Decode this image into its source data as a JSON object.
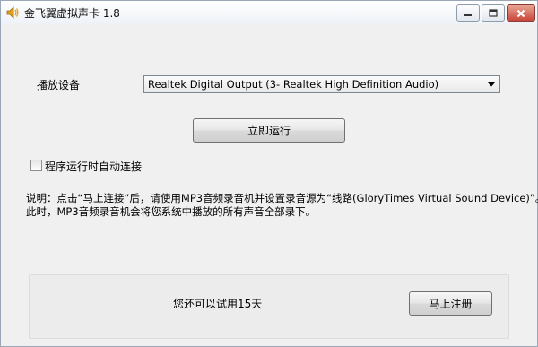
{
  "window": {
    "title": "金飞翼虚拟声卡 1.8",
    "icon": "speaker-icon"
  },
  "titlebar_buttons": {
    "minimize_icon": "minimize-icon",
    "maximize_icon": "maximize-icon",
    "close_icon": "close-icon"
  },
  "device": {
    "label": "播放设备",
    "selected": "Realtek Digital Output (3- Realtek High Definition Audio)"
  },
  "run_button": {
    "label": "立即运行"
  },
  "auto_connect": {
    "label": "程序运行时自动连接",
    "checked": false
  },
  "note": {
    "line1": "说明：点击“马上连接”后，请使用MP3音频录音机并设置录音源为“线路(GloryTimes Virtual Sound Device)”。",
    "line2": "此时，MP3音频录音机会将您系统中播放的所有声音全部录下。"
  },
  "trial": {
    "text": "您还可以试用15天",
    "register_label": "马上注册"
  },
  "colors": {
    "window_bg": "#f0f0f0",
    "close_button": "#c9473a",
    "border": "#7a8799"
  }
}
